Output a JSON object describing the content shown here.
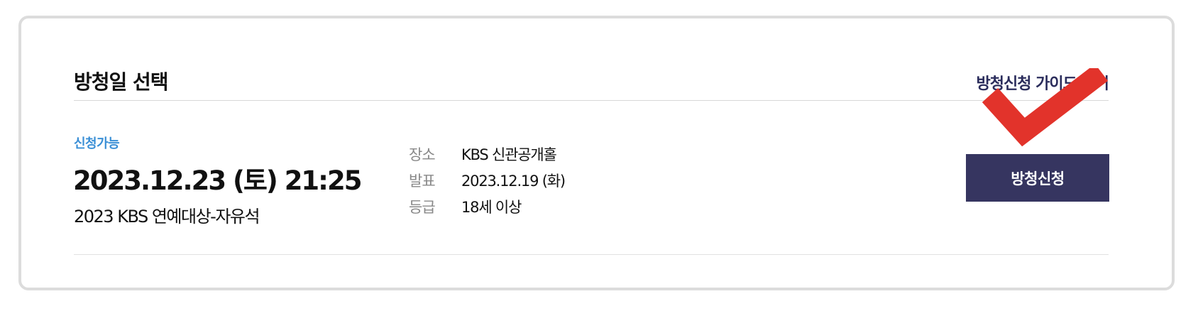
{
  "section": {
    "title": "방청일 선택",
    "guide_link": "방청신청 가이드 보기"
  },
  "event": {
    "status": "신청가능",
    "datetime": "2023.12.23 (토) 21:25",
    "name": "2023 KBS 연예대상-자유석"
  },
  "info": [
    {
      "label": "장소",
      "value": "KBS 신관공개홀"
    },
    {
      "label": "발표",
      "value": "2023.12.19 (화)"
    },
    {
      "label": "등급",
      "value": "18세 이상"
    }
  ],
  "actions": {
    "apply_label": "방청신청"
  },
  "colors": {
    "accent": "#363560",
    "status": "#3a8fd6",
    "checkmark": "#e2332b"
  }
}
